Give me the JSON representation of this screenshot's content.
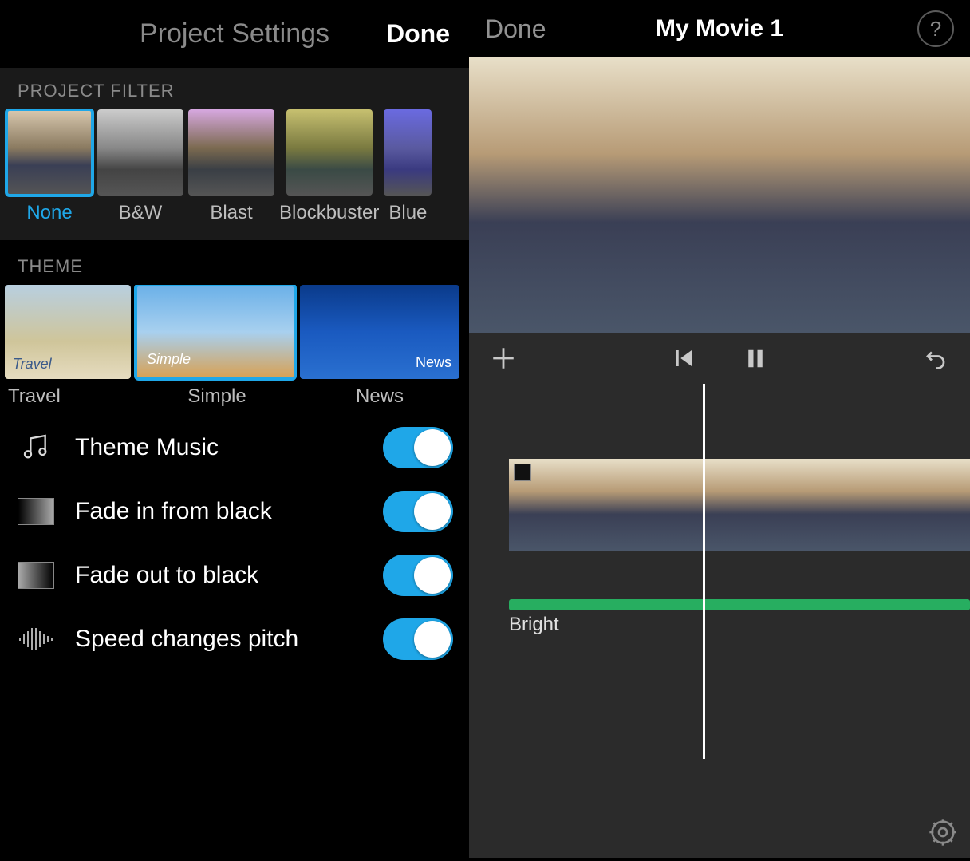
{
  "left": {
    "title": "Project Settings",
    "done": "Done",
    "filter_section": "PROJECT FILTER",
    "filters": [
      {
        "label": "None",
        "selected": true
      },
      {
        "label": "B&W",
        "selected": false
      },
      {
        "label": "Blast",
        "selected": false
      },
      {
        "label": "Blockbuster",
        "selected": false
      },
      {
        "label": "Blue",
        "selected": false
      }
    ],
    "theme_section": "THEME",
    "themes": [
      {
        "label": "Travel",
        "overlay": "Travel",
        "selected": false
      },
      {
        "label": "Simple",
        "overlay": "Simple",
        "selected": true
      },
      {
        "label": "News",
        "overlay": "News",
        "selected": false
      }
    ],
    "options": {
      "theme_music": {
        "label": "Theme Music",
        "on": true
      },
      "fade_in": {
        "label": "Fade in from black",
        "on": true
      },
      "fade_out": {
        "label": "Fade out to black",
        "on": true
      },
      "speed_pitch": {
        "label": "Speed changes pitch",
        "on": true
      }
    }
  },
  "right": {
    "done": "Done",
    "title": "My Movie 1",
    "help": "?",
    "audio_label": "Bright"
  }
}
